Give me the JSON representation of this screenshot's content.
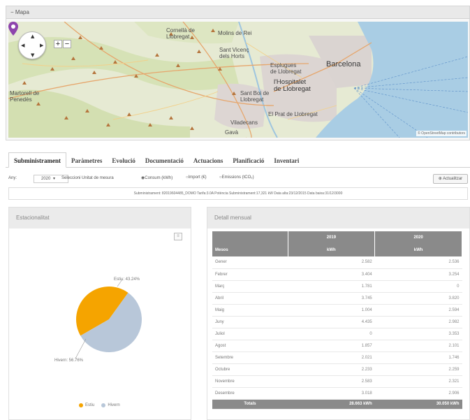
{
  "map": {
    "header_label": "Mapa",
    "zoom_in": "+",
    "zoom_out": "−",
    "attribution": "© OpenStreetMap contributors",
    "places": {
      "cornella": "Cornellà de\nLlobregat",
      "molins": "Molins de Rei",
      "sant_vicenc": "Sant Vicenç\ndels Horts",
      "esplugues": "Esplugues\nde Llobregat",
      "barcelona": "Barcelona",
      "hospitalet": "l'Hospitalet\nde Llobregat",
      "martorell": "Martorell de\nPenedès",
      "sant_boi": "Sant Boi de\nLlobregat",
      "prat": "El Prat de Llobregat",
      "viladecans": "Viladecans",
      "gava": "Gavà"
    },
    "colors": {
      "land": "#e8ebd8",
      "sea": "#a9cde4",
      "urban": "#dcd6d3",
      "forest": "#c9d9a8",
      "marker": "#8e44ad"
    }
  },
  "tabs": [
    {
      "label": "Subministrament",
      "active": true
    },
    {
      "label": "Paràmetres",
      "active": false
    },
    {
      "label": "Evolució",
      "active": false
    },
    {
      "label": "Documentació",
      "active": false
    },
    {
      "label": "Actuacions",
      "active": false
    },
    {
      "label": "Planificació",
      "active": false
    },
    {
      "label": "Inventari",
      "active": false
    }
  ],
  "controls": {
    "year_label": "Any:",
    "year_value": "2020",
    "unit_label": "Seleccioni Unitat de mesura",
    "radio_consum": "Consum (kWh)",
    "radio_import": "Import (€)",
    "radio_emissions": "Emissions (tCO₂)",
    "refresh_label": "Actualitzar"
  },
  "info_bar": "Subministrament: 82019604485_DOMO  Tarifa:3.0A  Potència Subministrament:17,321 kW  Data alta:23/12/2015  Data baixa:31/12/3000",
  "seasonality": {
    "title": "Estacionalitat",
    "menu_icon": "≡",
    "label_estiu": "Estiu: 43.24%",
    "label_hivern": "Hivern: 56.76%",
    "legend": [
      "Estiu",
      "Hivern"
    ]
  },
  "chart_data": {
    "type": "pie",
    "title": "",
    "slices": [
      {
        "name": "Estiu",
        "value": 43.24,
        "color": "#f5a400"
      },
      {
        "name": "Hivern",
        "value": 56.76,
        "color": "#b8c7d9"
      }
    ]
  },
  "monthly": {
    "title": "Detall mensual",
    "years": [
      "2019",
      "2020"
    ],
    "col_months": "Mesos",
    "unit": "kWh",
    "rows": [
      {
        "month": "Gener",
        "v2019": "2.582",
        "v2020": "2.536"
      },
      {
        "month": "Febrer",
        "v2019": "3.404",
        "v2020": "3.254"
      },
      {
        "month": "Març",
        "v2019": "1.781",
        "v2020": "0"
      },
      {
        "month": "Abril",
        "v2019": "3.745",
        "v2020": "3.820"
      },
      {
        "month": "Maig",
        "v2019": "1.004",
        "v2020": "2.594"
      },
      {
        "month": "Juny",
        "v2019": "4.435",
        "v2020": "2.982"
      },
      {
        "month": "Juliol",
        "v2019": "0",
        "v2020": "3.353"
      },
      {
        "month": "Agost",
        "v2019": "1.857",
        "v2020": "2.101"
      },
      {
        "month": "Setembre",
        "v2019": "2.021",
        "v2020": "1.746"
      },
      {
        "month": "Octubre",
        "v2019": "2.233",
        "v2020": "2.259"
      },
      {
        "month": "Novembre",
        "v2019": "2.583",
        "v2020": "2.321"
      },
      {
        "month": "Desembre",
        "v2019": "3.018",
        "v2020": "2.906"
      }
    ],
    "totals_label": "Totals",
    "total_2019": "28.663 kWh",
    "total_2020": "30.050 kWh"
  }
}
